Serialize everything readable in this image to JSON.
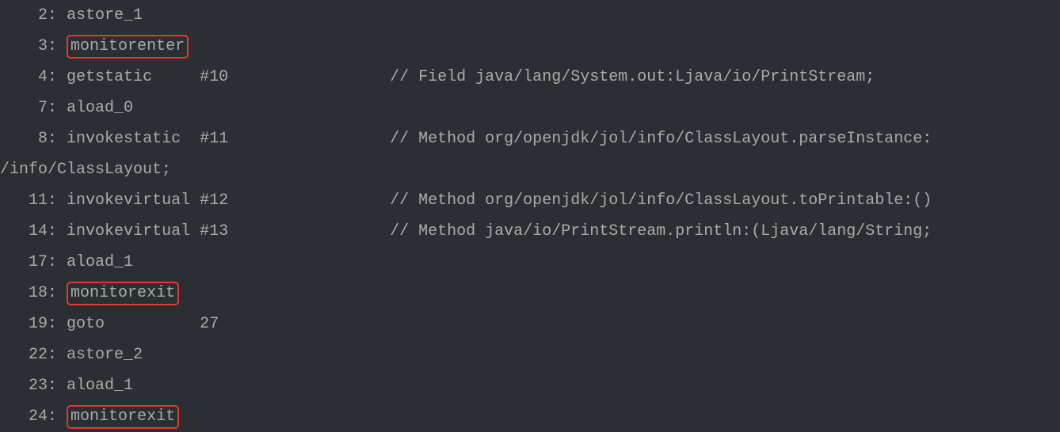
{
  "lines": [
    {
      "indent": "    ",
      "offset": "2:",
      "sp1": " ",
      "instruction": "astore_1",
      "highlighted": false
    },
    {
      "indent": "    ",
      "offset": "3:",
      "sp1": " ",
      "instruction": "monitorenter",
      "highlighted": true
    },
    {
      "indent": "    ",
      "offset": "4:",
      "sp1": " ",
      "instruction": "getstatic",
      "sp2": "     ",
      "operand": "#10",
      "sp3": "                 ",
      "comment": "// Field java/lang/System.out:Ljava/io/PrintStream;",
      "highlighted": false
    },
    {
      "indent": "    ",
      "offset": "7:",
      "sp1": " ",
      "instruction": "aload_0",
      "highlighted": false
    },
    {
      "indent": "    ",
      "offset": "8:",
      "sp1": " ",
      "instruction": "invokestatic",
      "sp2": "  ",
      "operand": "#11",
      "sp3": "                 ",
      "comment": "// Method org/openjdk/jol/info/ClassLayout.parseInstance:",
      "highlighted": false
    },
    {
      "indent": "",
      "offset": "",
      "sp1": "",
      "instruction": "/info/ClassLayout;",
      "highlighted": false
    },
    {
      "indent": "   ",
      "offset": "11:",
      "sp1": " ",
      "instruction": "invokevirtual",
      "sp2": " ",
      "operand": "#12",
      "sp3": "                 ",
      "comment": "// Method org/openjdk/jol/info/ClassLayout.toPrintable:()",
      "highlighted": false
    },
    {
      "indent": "   ",
      "offset": "14:",
      "sp1": " ",
      "instruction": "invokevirtual",
      "sp2": " ",
      "operand": "#13",
      "sp3": "                 ",
      "comment": "// Method java/io/PrintStream.println:(Ljava/lang/String;",
      "highlighted": false
    },
    {
      "indent": "   ",
      "offset": "17:",
      "sp1": " ",
      "instruction": "aload_1",
      "highlighted": false
    },
    {
      "indent": "   ",
      "offset": "18:",
      "sp1": " ",
      "instruction": "monitorexit",
      "highlighted": true
    },
    {
      "indent": "   ",
      "offset": "19:",
      "sp1": " ",
      "instruction": "goto",
      "sp2": "          ",
      "operand": "27",
      "highlighted": false
    },
    {
      "indent": "   ",
      "offset": "22:",
      "sp1": " ",
      "instruction": "astore_2",
      "highlighted": false
    },
    {
      "indent": "   ",
      "offset": "23:",
      "sp1": " ",
      "instruction": "aload_1",
      "highlighted": false
    },
    {
      "indent": "   ",
      "offset": "24:",
      "sp1": " ",
      "instruction": "monitorexit",
      "highlighted": true
    }
  ]
}
